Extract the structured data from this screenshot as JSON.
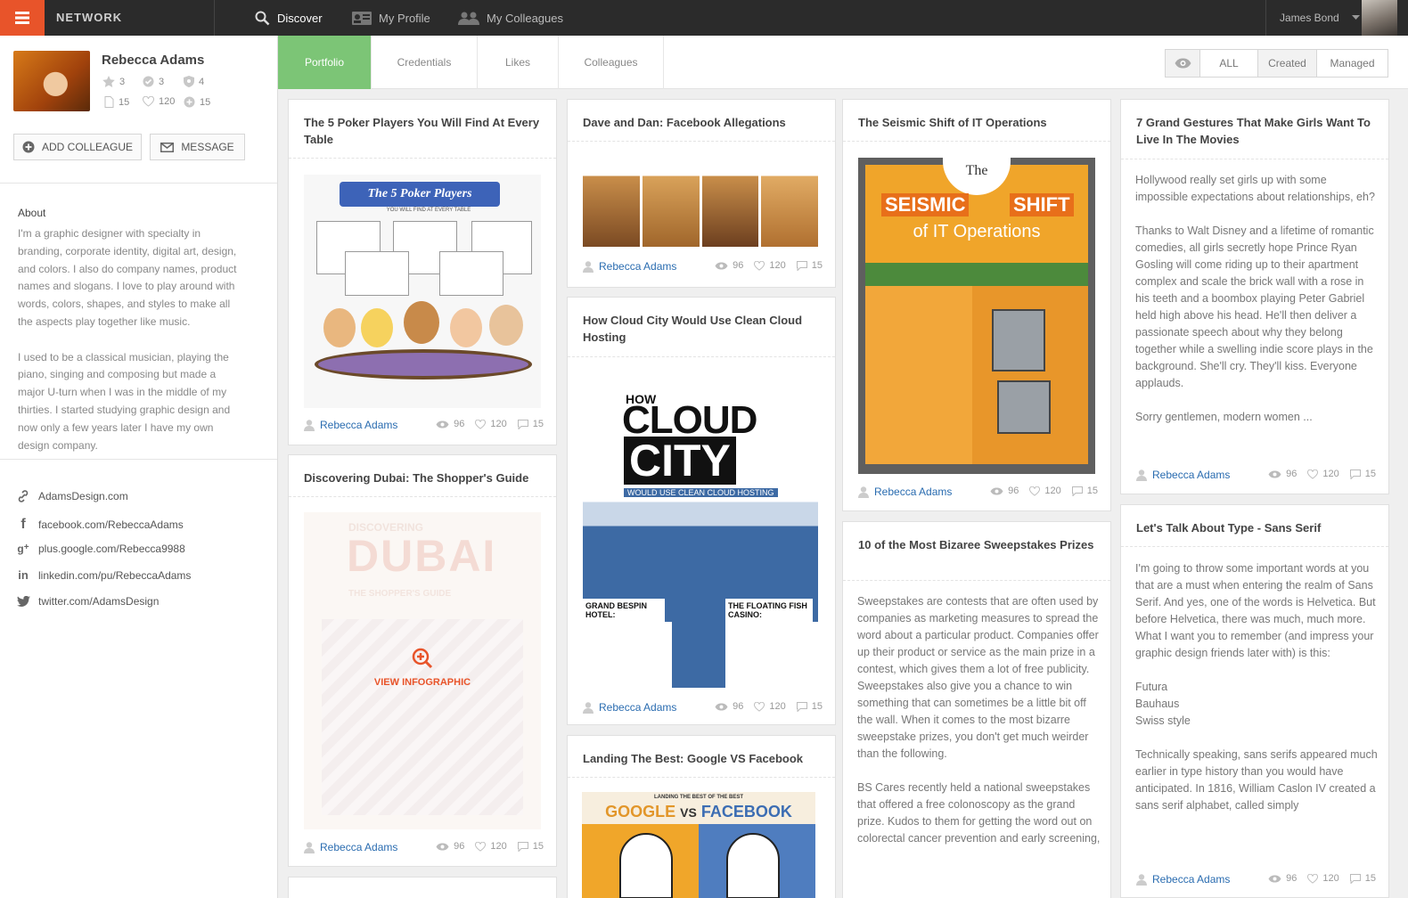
{
  "topbar": {
    "brand": "NETWORK",
    "nav": [
      {
        "label": "Discover",
        "icon": "search-icon"
      },
      {
        "label": "My Profile",
        "icon": "id-card-icon"
      },
      {
        "label": "My Colleagues",
        "icon": "users-icon"
      }
    ],
    "user_name": "James Bond"
  },
  "profile": {
    "name": "Rebecca Adams",
    "stats_row1": [
      "3",
      "3",
      "4"
    ],
    "stats_row2": [
      "15",
      "120",
      "15"
    ],
    "add_colleague": "ADD COLLEAGUE",
    "message": "MESSAGE",
    "about_title": "About",
    "about_p1": "I'm a graphic designer with specialty in branding, corporate identity, digital art, design, and colors. I also do company names, product names and slogans. I love to play around with words, colors, shapes, and styles to make all the aspects play together like music.",
    "about_p2": "I used to be a classical musician, playing the piano, singing and composing but made a major U-turn when I was in the middle of my thirties. I started studying graphic design and now only a few years later I have my own design company.",
    "links": [
      {
        "icon": "link-icon",
        "text": "AdamsDesign.com"
      },
      {
        "icon": "facebook-icon",
        "text": "facebook.com/RebeccaAdams"
      },
      {
        "icon": "google-plus-icon",
        "text": "plus.google.com/Rebecca9988"
      },
      {
        "icon": "linkedin-icon",
        "text": "linkedin.com/pu/RebeccaAdams"
      },
      {
        "icon": "twitter-icon",
        "text": "twitter.com/AdamsDesign"
      }
    ]
  },
  "tabs": [
    "Portfolio",
    "Credentials",
    "Likes",
    "Colleagues"
  ],
  "filter": [
    "ALL",
    "Created",
    "Managed"
  ],
  "card_meta": {
    "author": "Rebecca Adams",
    "views": "96",
    "likes": "120",
    "comments": "15"
  },
  "cards": {
    "poker": {
      "title": "The 5 Poker Players You Will Find At Every Table",
      "img_title": "The 5 Poker Players",
      "img_sub": "YOU WILL FIND AT EVERY TABLE"
    },
    "dubai": {
      "title": "Discovering Dubai: The Shopper's Guide",
      "img_title": "DUBAI",
      "img_top": "DISCOVERING",
      "img_sub": "THE SHOPPER'S GUIDE",
      "overlay": "VIEW INFOGRAPHIC"
    },
    "dave": {
      "title": "Dave and Dan: Facebook Allegations"
    },
    "cloud": {
      "title": "How Cloud City Would Use Clean Cloud Hosting",
      "img_how": "HOW",
      "img_line1": "CLOUD",
      "img_line2": "CITY",
      "img_sub": "WOULD USE CLEAN CLOUD HOSTING",
      "img_left": "GRAND BESPIN HOTEL:",
      "img_right": "THE FLOATING FISH CASINO:"
    },
    "landing": {
      "title": "Landing The Best: Google VS Facebook",
      "img_top": "LANDING THE BEST OF THE BEST",
      "img_google": "GOOGLE",
      "img_vs": "VS",
      "img_facebook": "FACEBOOK"
    },
    "seismic": {
      "title": "The Seismic Shift of IT Operations",
      "img_the": "The",
      "img_seismic": "SEISMIC",
      "img_shift": "SHIFT",
      "img_sub": "of IT Operations"
    },
    "sweep": {
      "title": "10 of the Most Bizaree Sweepstakes Prizes",
      "p1": "Sweepstakes are contests that are often used by companies as marketing measures to spread the word about a particular product. Companies offer up their product or service as the main prize in a contest, which gives them a lot of free publicity. Sweepstakes also give you a chance to win something that can sometimes be a little bit off the wall. When it comes to the most bizarre sweepstake prizes, you don't get much weirder than the following.",
      "p2": "BS Cares recently held a national sweepstakes that offered a free colonoscopy as the grand prize. Kudos to them for getting the word out on colorectal cancer prevention and early screening,"
    },
    "gestures": {
      "title": "7 Grand Gestures That Make Girls Want To Live In The Movies",
      "p1": "Hollywood really set girls up with some impossible expectations about relationships, eh?",
      "p2": "Thanks to Walt Disney and a lifetime of romantic comedies, all girls secretly hope Prince Ryan Gosling will come riding up to their apartment complex and scale the brick wall with a rose in his teeth and a boombox playing Peter Gabriel held high above his head. He'll then deliver a passionate speech about why they belong together while a swelling indie score plays in the background. She'll cry. They'll kiss. Everyone applauds.",
      "p3": "Sorry gentlemen, modern women ..."
    },
    "type": {
      "title": "Let's Talk About Type - Sans Serif",
      "p1": "I'm going to throw some important words at you that are a must when entering the realm of Sans Serif. And yes, one of the words is Helvetica. But before Helvetica, there was much, much more. What I want you to remember (and impress your graphic design friends later with) is this:",
      "list": [
        "Futura",
        "Bauhaus",
        "Swiss style"
      ],
      "p2": "Technically speaking, sans serifs appeared much earlier in type history than you would have anticipated. In 1816, William Caslon IV created a sans serif alphabet, called simply"
    }
  },
  "colors": {
    "accent": "#e8542a",
    "active_tab": "#7cc576",
    "link": "#2a6cb0",
    "topbar": "#2b2b2b"
  }
}
